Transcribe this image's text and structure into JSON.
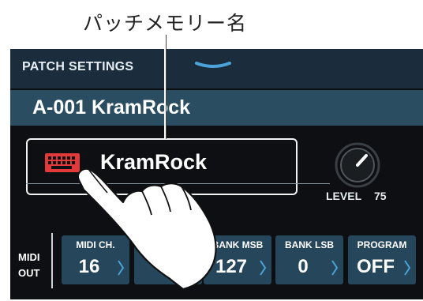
{
  "callout": {
    "label": "パッチメモリー名"
  },
  "header": {
    "title": "PATCH SETTINGS",
    "chevron_icon": "chevron-down-icon"
  },
  "patch": {
    "id_and_name": "A-001 KramRock"
  },
  "patch_name_field": {
    "value": "KramRock",
    "icon": "keyboard-icon",
    "icon_color": "#e23a3a"
  },
  "level": {
    "label": "LEVEL",
    "value": "75"
  },
  "midi": {
    "section_label_line1": "MIDI",
    "section_label_line2": "OUT",
    "params": [
      {
        "label": "MIDI CH.",
        "value": "16"
      },
      {
        "label": "BANK MSB",
        "value": "127"
      },
      {
        "label": "BANK LSB",
        "value": "0"
      },
      {
        "label": "PROGRAM",
        "value": "OFF"
      }
    ]
  },
  "colors": {
    "header_bg": "#1b2d3d",
    "namebar_bg": "#2a4d62",
    "param_bg": "#25465b",
    "accent_arrow": "#4aa3d9"
  }
}
